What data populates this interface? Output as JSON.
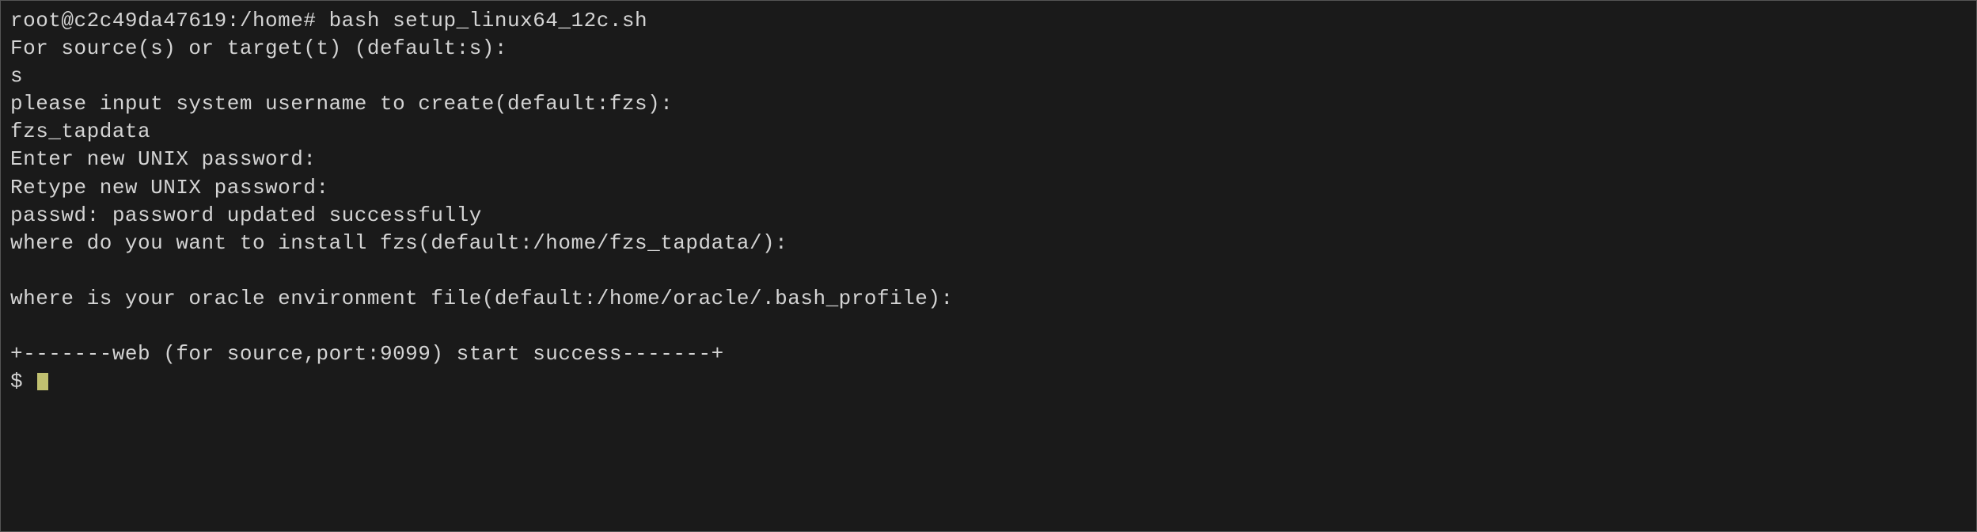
{
  "terminal": {
    "lines": [
      "root@c2c49da47619:/home# bash setup_linux64_12c.sh",
      "For source(s) or target(t) (default:s):",
      "s",
      "please input system username to create(default:fzs):",
      "fzs_tapdata",
      "Enter new UNIX password:",
      "Retype new UNIX password:",
      "passwd: password updated successfully",
      "where do you want to install fzs(default:/home/fzs_tapdata/):",
      "",
      "where is your oracle environment file(default:/home/oracle/.bash_profile):",
      "",
      "+-------web (for source,port:9099) start success-------+"
    ],
    "prompt_partial": "$ "
  }
}
